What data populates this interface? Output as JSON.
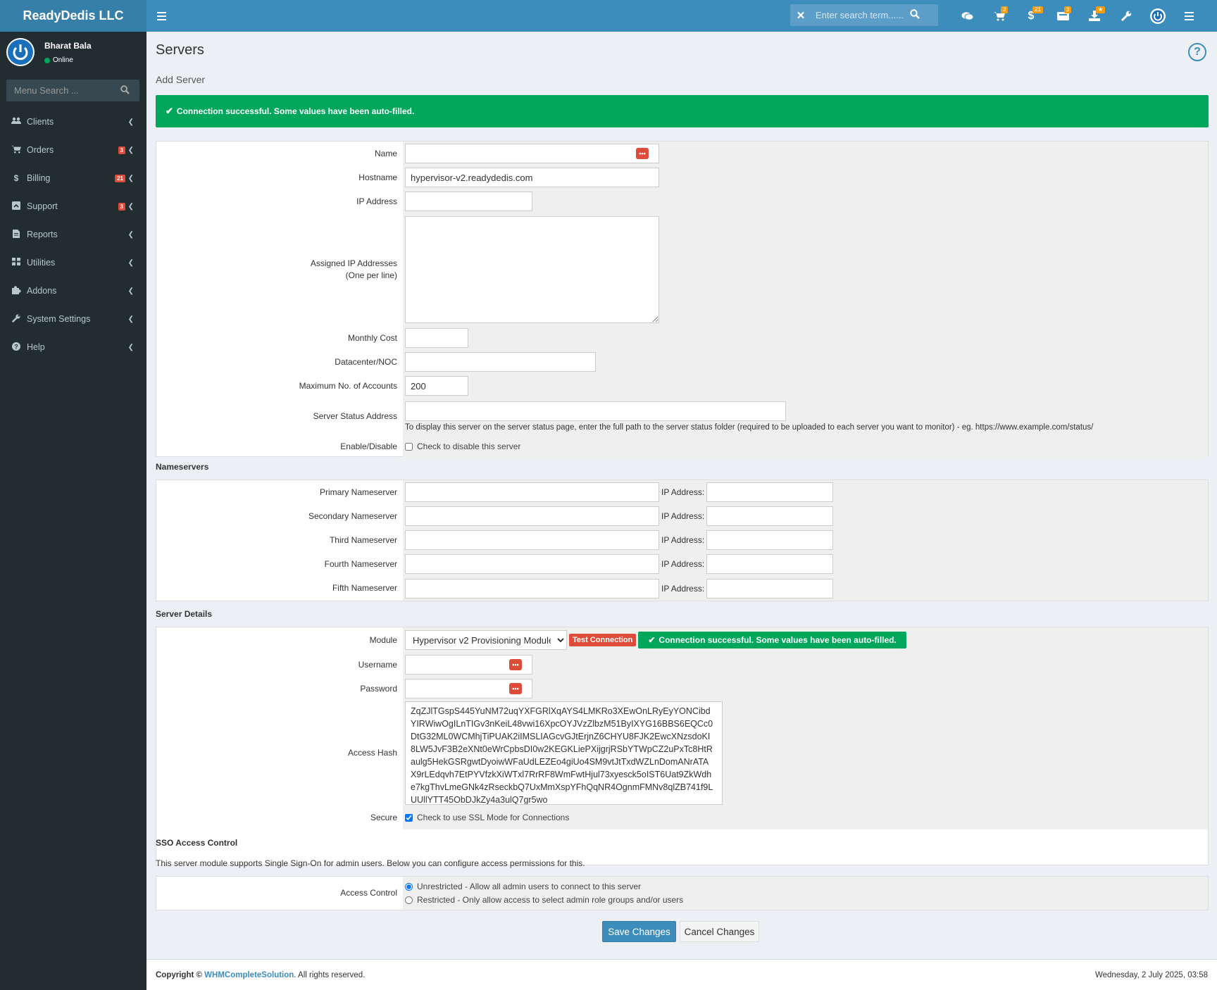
{
  "brand": "ReadyDedis LLC",
  "topbar": {
    "search_placeholder": "Enter search term......",
    "badges": {
      "cart": "3",
      "dollar": "21",
      "ticket": "3",
      "download": "★"
    }
  },
  "user": {
    "name": "Bharat Bala",
    "status": "Online"
  },
  "sidebar": {
    "search_placeholder": "Menu Search ...",
    "items": [
      {
        "label": "Clients",
        "icon": "users-icon",
        "badge": ""
      },
      {
        "label": "Orders",
        "icon": "cart-icon",
        "badge": "3"
      },
      {
        "label": "Billing",
        "icon": "dollar-icon",
        "badge": "21"
      },
      {
        "label": "Support",
        "icon": "support-icon",
        "badge": "3"
      },
      {
        "label": "Reports",
        "icon": "file-icon",
        "badge": ""
      },
      {
        "label": "Utilities",
        "icon": "grid-icon",
        "badge": ""
      },
      {
        "label": "Addons",
        "icon": "puzzle-icon",
        "badge": ""
      },
      {
        "label": "System Settings",
        "icon": "wrench-icon",
        "badge": ""
      },
      {
        "label": "Help",
        "icon": "question-icon",
        "badge": ""
      }
    ]
  },
  "page": {
    "title": "Servers",
    "subtitle": "Add Server",
    "alert": "Connection successful. Some values have been auto-filled."
  },
  "form": {
    "name_label": "Name",
    "hostname_label": "Hostname",
    "hostname_value": "hypervisor-v2.readydedis.com",
    "ip_label": "IP Address",
    "assigned_ips_label": "Assigned IP Addresses",
    "assigned_ips_hint": "(One per line)",
    "monthly_cost_label": "Monthly Cost",
    "datacenter_label": "Datacenter/NOC",
    "max_accounts_label": "Maximum No. of Accounts",
    "max_accounts_value": "200",
    "status_address_label": "Server Status Address",
    "status_address_help": "To display this server on the server status page, enter the full path to the server status folder (required to be uploaded to each server you want to monitor) - eg. https://www.example.com/status/",
    "enable_label": "Enable/Disable",
    "enable_check": "Check to disable this server"
  },
  "nameservers": {
    "heading": "Nameservers",
    "ip_label": "IP Address:",
    "rows": [
      "Primary Nameserver",
      "Secondary Nameserver",
      "Third Nameserver",
      "Fourth Nameserver",
      "Fifth Nameserver"
    ]
  },
  "details": {
    "heading": "Server Details",
    "module_label": "Module",
    "module_value": "Hypervisor v2 Provisioning Module",
    "test_button": "Test Connection",
    "test_result": "Connection successful. Some values have been auto-filled.",
    "username_label": "Username",
    "password_label": "Password",
    "hash_label": "Access Hash",
    "hash_value": "ZqZJlTGspS445YuNM72uqYXFGRlXqAYS4LMKRo3XEwOnLRyEyYONCibd\nYIRWiwOgILnTIGv3nKeiL48vwi16XpcOYJVzZlbzM51ByIXYG16BBS6EQCc0\nDtG32ML0WCMhjTiPUAK2iIMSLIAGcvGJtErjnZ6CHYU8FJK2EwcXNzsdoKI\n8LW5JvF3B2eXNt0eWrCpbsDI0w2KEGKLiePXijgrjRSbYTWpCZ2uPxTc8HtR\naulg5HekGSRgwtDyoiwWFaUdLEZEo4giUo4SM9vtJtTxdWZLnDomANrATA\nX9rLEdqvh7EtPYVfzkXiWTxl7RrRF8WmFwtHjul73xyesck5oIST6Uat9ZkWdh\ne7kgThvLmeGNk4zRseckbQ7UxMmXspYFhQqNR4OgnmFMNv8qlZB741f9L\nUUllYTT45ObDJkZy4a3ulQ7gr5wo",
    "secure_label": "Secure",
    "secure_check": "Check to use SSL Mode for Connections"
  },
  "sso": {
    "heading": "SSO Access Control",
    "description": "This server module supports Single Sign-On for admin users. Below you can configure access permissions for this.",
    "label": "Access Control",
    "option1": "Unrestricted - Allow all admin users to connect to this server",
    "option2": "Restricted - Only allow access to select admin role groups and/or users"
  },
  "buttons": {
    "save": "Save Changes",
    "cancel": "Cancel Changes"
  },
  "footer": {
    "copyright_prefix": "Copyright ©",
    "company": "WHMCompleteSolution",
    "suffix": ". All rights reserved.",
    "datetime": "Wednesday, 2 July 2025, 03:58"
  },
  "colors": {
    "header": "#3c8dbc",
    "sidebar": "#222d32",
    "success": "#00a65a",
    "danger": "#dd4b39"
  }
}
